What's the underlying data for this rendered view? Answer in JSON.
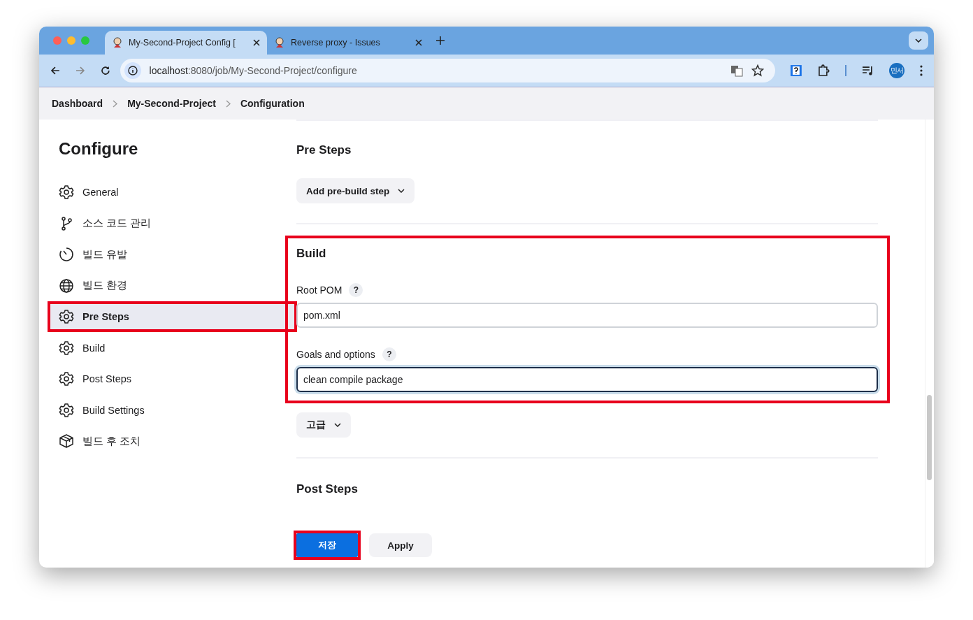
{
  "browser": {
    "tabs": [
      {
        "title": "My-Second-Project Config [",
        "selected": true
      },
      {
        "title": "Reverse proxy - Issues",
        "selected": false
      }
    ],
    "url": {
      "host": "localhost",
      "path": ":8080/job/My-Second-Project/configure"
    },
    "profile": "민서"
  },
  "breadcrumbs": [
    "Dashboard",
    "My-Second-Project",
    "Configuration"
  ],
  "sidebar": {
    "title": "Configure",
    "items": [
      {
        "label": "General",
        "kind": "gear",
        "selected": false,
        "highlighted": false
      },
      {
        "label": "소스 코드 관리",
        "kind": "branch",
        "selected": false,
        "highlighted": false
      },
      {
        "label": "빌드 유발",
        "kind": "timer",
        "selected": false,
        "highlighted": false
      },
      {
        "label": "빌드 환경",
        "kind": "globe",
        "selected": false,
        "highlighted": false
      },
      {
        "label": "Pre Steps",
        "kind": "gear",
        "selected": true,
        "highlighted": true
      },
      {
        "label": "Build",
        "kind": "gear",
        "selected": false,
        "highlighted": false
      },
      {
        "label": "Post Steps",
        "kind": "gear",
        "selected": false,
        "highlighted": false
      },
      {
        "label": "Build Settings",
        "kind": "gear",
        "selected": false,
        "highlighted": false
      },
      {
        "label": "빌드 후 조치",
        "kind": "box",
        "selected": false,
        "highlighted": false
      }
    ]
  },
  "pre_steps": {
    "title": "Pre Steps",
    "button": "Add pre-build step"
  },
  "build": {
    "title": "Build",
    "highlighted": true,
    "fields": [
      {
        "label": "Root POM",
        "help": "?",
        "value": "pom.xml",
        "focused": false
      },
      {
        "label": "Goals and options",
        "help": "?",
        "value": "clean compile package",
        "focused": true
      }
    ],
    "advanced": "고급"
  },
  "post_steps": {
    "title": "Post Steps"
  },
  "footer": {
    "save": "저장",
    "save_highlighted": true,
    "apply": "Apply"
  }
}
